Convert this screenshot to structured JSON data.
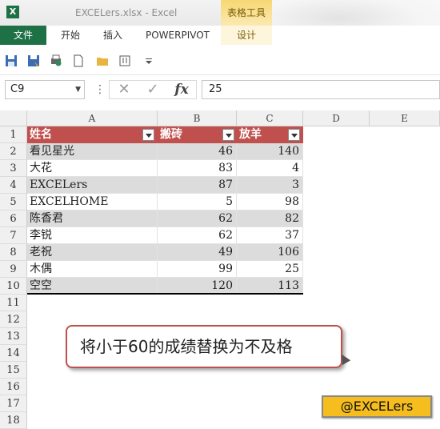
{
  "window": {
    "title": "EXCELers.xlsx - Excel",
    "context_tab_group": "表格工具"
  },
  "ribbon": {
    "tabs": [
      {
        "label": "文件"
      },
      {
        "label": "开始"
      },
      {
        "label": "插入"
      },
      {
        "label": "POWERPIVOT"
      },
      {
        "label": "设计"
      }
    ]
  },
  "qat": {
    "icons": [
      "save-icon",
      "save-as-icon",
      "print-preview-icon",
      "new-document-icon",
      "open-folder-icon",
      "attach-icon",
      "customize-dropdown-icon"
    ]
  },
  "formula_bar": {
    "name_box": "C9",
    "formula": "25",
    "fx_label": "fx"
  },
  "sheet": {
    "columns": [
      "A",
      "B",
      "C",
      "D",
      "E"
    ],
    "rows": [
      "1",
      "2",
      "3",
      "4",
      "5",
      "6",
      "7",
      "8",
      "9",
      "10",
      "11",
      "12",
      "13",
      "14",
      "15",
      "16",
      "17",
      "18"
    ],
    "table": {
      "headers": [
        "姓名",
        "搬砖",
        "放羊"
      ],
      "data": [
        [
          "看见星光",
          "46",
          "140"
        ],
        [
          "大花",
          "83",
          "4"
        ],
        [
          "EXCELers",
          "87",
          "3"
        ],
        [
          "EXCELHOME",
          "5",
          "98"
        ],
        [
          "陈香君",
          "62",
          "82"
        ],
        [
          "李锐",
          "62",
          "37"
        ],
        [
          "老祝",
          "49",
          "106"
        ],
        [
          "木偶",
          "99",
          "25"
        ],
        [
          "空空",
          "120",
          "113"
        ]
      ]
    },
    "header_color": "#c0504d",
    "band_color": "#dcdcdc"
  },
  "callout": {
    "text": "将小于60的成绩替换为不及格"
  },
  "watermark": {
    "text": "@EXCELers"
  }
}
